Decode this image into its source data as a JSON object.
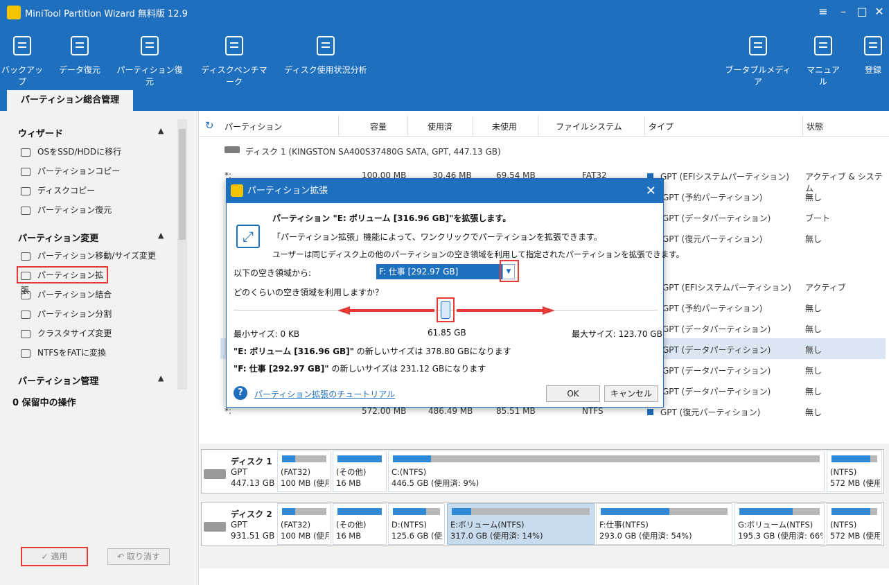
{
  "app": {
    "title": "MiniTool Partition Wizard 無料版 12.9"
  },
  "toolbar": [
    {
      "label": "バックアップ",
      "icon": "backup-icon"
    },
    {
      "label": "データ復元",
      "icon": "data-recovery-icon"
    },
    {
      "label": "パーティション復元",
      "icon": "partition-recovery-icon"
    },
    {
      "label": "ディスクベンチマーク",
      "icon": "benchmark-icon"
    },
    {
      "label": "ディスク使用状況分析",
      "icon": "space-analyzer-icon"
    }
  ],
  "toolbar_right": [
    {
      "label": "ブータブルメディア",
      "icon": "usb-icon"
    },
    {
      "label": "マニュアル",
      "icon": "manual-icon"
    },
    {
      "label": "登録",
      "icon": "register-icon"
    }
  ],
  "main_tab": "パーティション総合管理",
  "sidebar": {
    "wizard": {
      "title": "ウィザード",
      "items": [
        "OSをSSD/HDDに移行",
        "パーティションコピー",
        "ディスクコピー",
        "パーティション復元"
      ]
    },
    "change": {
      "title": "パーティション変更",
      "items": [
        "パーティション移動/サイズ変更",
        "パーティション拡張",
        "パーティション結合",
        "パーティション分割",
        "クラスタサイズ変更",
        "NTFSをFATに変換"
      ]
    },
    "manage": {
      "title": "パーティション管理"
    },
    "pending": "0 保留中の操作",
    "apply": "✓ 適用",
    "undo": "↶ 取り消す"
  },
  "table": {
    "headers": [
      "パーティション",
      "容量",
      "使用済",
      "未使用",
      "ファイルシステム",
      "タイプ",
      "状態"
    ],
    "disk1": "ディスク 1 (KINGSTON SA400S37480G SATA, GPT, 447.13 GB)",
    "rows": [
      {
        "p": "*:",
        "cap": "100.00 MB",
        "used": "30.46 MB",
        "free": "69.54 MB",
        "fs": "FAT32",
        "type": "GPT (EFIシステムパーティション)",
        "status": "アクティブ & システム"
      },
      {
        "type": "GPT (予約パーティション)",
        "status": "無し"
      },
      {
        "type": "GPT (データパーティション)",
        "status": "ブート"
      },
      {
        "type": "GPT (復元パーティション)",
        "status": "無し"
      },
      {
        "type": "GPT (EFIシステムパーティション)",
        "status": "アクティブ"
      },
      {
        "type": "GPT (予約パーティション)",
        "status": "無し"
      },
      {
        "type": "GPT (データパーティション)",
        "status": "無し"
      },
      {
        "type": "GPT (データパーティション)",
        "status": "無し"
      },
      {
        "type": "GPT (データパーティション)",
        "status": "無し"
      },
      {
        "type": "GPT (データパーティション)",
        "status": "無し"
      },
      {
        "p": "*:",
        "cap": "572.00 MB",
        "used": "486.49 MB",
        "free": "85.51 MB",
        "fs": "NTFS",
        "type": "GPT (復元パーティション)",
        "status": "無し"
      }
    ]
  },
  "diskmap": {
    "disk1": {
      "name": "ディスク 1",
      "type": "GPT",
      "size": "447.13 GB",
      "parts": [
        {
          "l1": "(FAT32)",
          "l2": "100 MB (使月",
          "fill": 0.3
        },
        {
          "l1": "(その他)",
          "l2": "16 MB",
          "fill": 1.0
        },
        {
          "l1": "C:(NTFS)",
          "l2": "446.5 GB (使用済: 9%)",
          "fill": 0.09
        },
        {
          "l1": "(NTFS)",
          "l2": "572 MB (使用",
          "fill": 0.85
        }
      ]
    },
    "disk2": {
      "name": "ディスク 2",
      "type": "GPT",
      "size": "931.51 GB",
      "parts": [
        {
          "l1": "(FAT32)",
          "l2": "100 MB (使月",
          "fill": 0.3
        },
        {
          "l1": "(その他)",
          "l2": "16 MB",
          "fill": 1.0
        },
        {
          "l1": "D:(NTFS)",
          "l2": "125.6 GB (使用",
          "fill": 0.7
        },
        {
          "l1": "E:ボリューム(NTFS)",
          "l2": "317.0 GB (使用済: 14%)",
          "fill": 0.14
        },
        {
          "l1": "F:仕事(NTFS)",
          "l2": "293.0 GB (使用済: 54%)",
          "fill": 0.54
        },
        {
          "l1": "G:ボリューム(NTFS)",
          "l2": "195.3 GB (使用済: 66%",
          "fill": 0.66
        },
        {
          "l1": "(NTFS)",
          "l2": "572 MB (使用",
          "fill": 0.85
        }
      ]
    }
  },
  "dialog": {
    "title": "パーティション拡張",
    "heading": "パーティション \"E: ボリューム [316.96 GB]\"を拡張します。",
    "desc1": "「パーティション拡張」機能によって、ワンクリックでパーティションを拡張できます。",
    "desc2": "ユーザーは同じディスク上の他のパーティションの空き領域を利用して指定されたパーティションを拡張できます。",
    "from_label": "以下の空き領域から:",
    "from_value": "F: 仕事 [292.97 GB]",
    "how_much": "どのくらいの空き領域を利用しますか？",
    "min": "最小サイズ: 0 KB",
    "current": "61.85 GB",
    "max": "最大サイズ: 123.70 GB",
    "slider_fraction": 0.5,
    "e_name": "\"E: ボリューム [316.96 GB]\"",
    "e_new": "の新しいサイズは 378.80 GBになります",
    "f_name": "\"F: 仕事 [292.97 GB]\"",
    "f_new": "の新しいサイズは 231.12 GBになります",
    "tutorial": "パーティション拡張のチュートリアル",
    "ok": "OK",
    "cancel": "キャンセル"
  },
  "colors": {
    "accent": "#1f6fbf",
    "highlight": "#e53935",
    "selected_row": "#dbe6f3"
  }
}
